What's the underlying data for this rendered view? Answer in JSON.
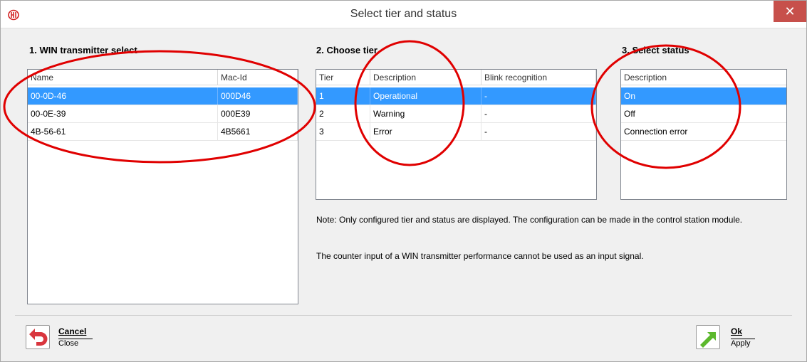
{
  "window": {
    "title": "Select tier and status",
    "close_symbol": "✕",
    "logo_icon": "app-logo-icon"
  },
  "transmitter": {
    "heading": "1. WIN transmitter select",
    "columns": [
      "Name",
      "Mac-Id"
    ],
    "rows": [
      {
        "name": "00-0D-46",
        "mac": "000D46",
        "selected": true
      },
      {
        "name": "00-0E-39",
        "mac": "000E39",
        "selected": false
      },
      {
        "name": "4B-56-61",
        "mac": "4B5661",
        "selected": false
      }
    ]
  },
  "tier": {
    "heading": "2. Choose tier",
    "columns": [
      "Tier",
      "Description",
      "Blink recognition"
    ],
    "rows": [
      {
        "tier": "1",
        "description": "Operational",
        "blink": "-",
        "selected": true
      },
      {
        "tier": "2",
        "description": "Warning",
        "blink": "-",
        "selected": false
      },
      {
        "tier": "3",
        "description": "Error",
        "blink": "-",
        "selected": false
      }
    ]
  },
  "status": {
    "heading": "3. Select status",
    "columns": [
      "Description"
    ],
    "rows": [
      {
        "description": "On",
        "selected": true
      },
      {
        "description": "Off",
        "selected": false
      },
      {
        "description": "Connection error",
        "selected": false
      }
    ]
  },
  "notes": {
    "note1": "Note: Only configured tier and status are displayed. The configuration can be made in the control station module.",
    "note2": "The counter input of a WIN transmitter performance cannot be used as an input signal."
  },
  "footer": {
    "cancel_label": "Cancel",
    "cancel_sub": "Close",
    "cancel_icon": "undo-arrow-icon",
    "ok_label": "Ok",
    "ok_sub": "Apply",
    "ok_icon": "green-arrow-icon"
  },
  "colors": {
    "selection": "#3399ff",
    "close_button": "#c7504b",
    "annotation": "#e00000"
  }
}
